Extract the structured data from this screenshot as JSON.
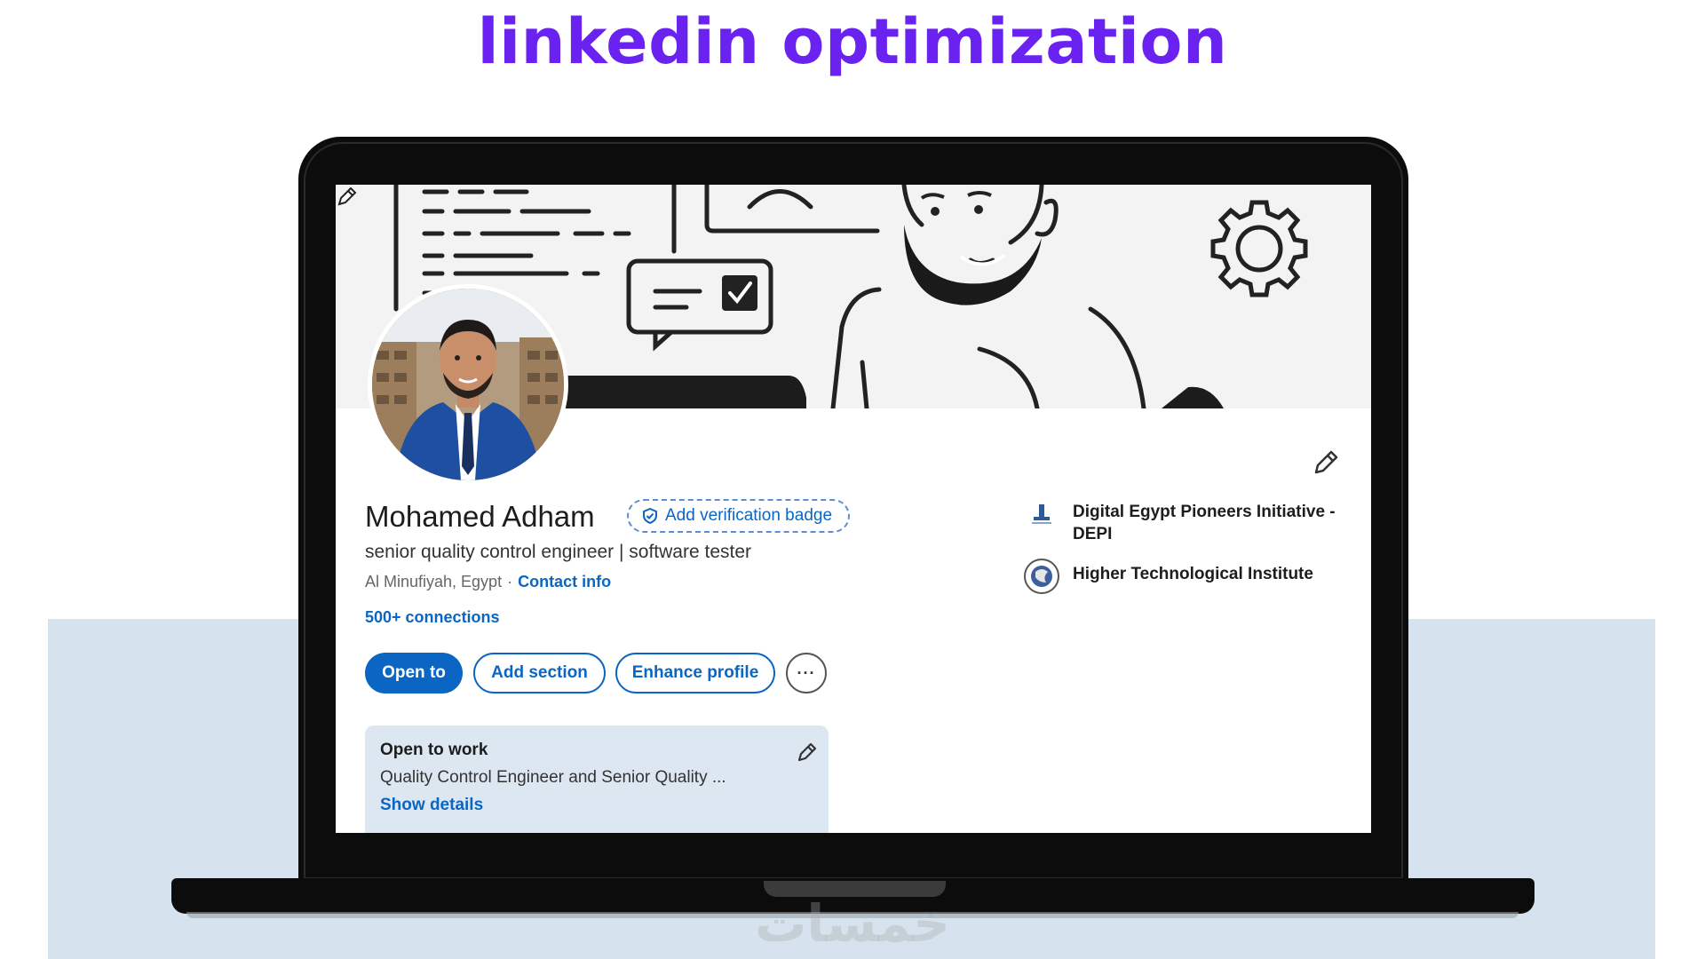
{
  "page": {
    "headline": "linkedin optimization",
    "watermark": "خمسات"
  },
  "profile": {
    "name": "Mohamed Adham",
    "verification_badge_label": "Add verification badge",
    "headline": "senior quality control engineer | software tester",
    "location": "Al Minufiyah, Egypt",
    "separator": "·",
    "contact_info_label": "Contact info",
    "connections_label": "500+ connections"
  },
  "actions": {
    "open_to_label": "Open to",
    "add_section_label": "Add section",
    "enhance_profile_label": "Enhance profile",
    "more_label": "···"
  },
  "open_to_work": {
    "title": "Open to work",
    "description": "Quality Control Engineer and Senior Quality ...",
    "show_details_label": "Show details"
  },
  "education": [
    {
      "name": "Digital Egypt Pioneers Initiative - DEPI",
      "logo_icon": "depi-logo"
    },
    {
      "name": "Higher Technological Institute",
      "logo_icon": "hti-logo"
    }
  ],
  "colors": {
    "headline_purple": "#6a22f0",
    "linkedin_blue": "#0a66c2",
    "band_blue": "#d6e3ee",
    "open_to_work_bg": "#dde7f1"
  },
  "icons": {
    "banner_edit": "pencil-icon",
    "card_edit": "pencil-icon",
    "open_to_work_edit": "pencil-icon",
    "verification": "shield-check-icon"
  }
}
